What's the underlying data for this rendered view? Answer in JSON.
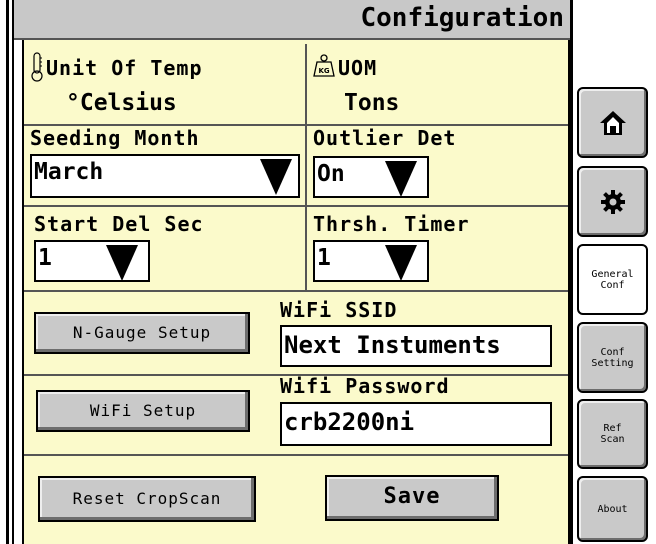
{
  "header": {
    "title": "Configuration"
  },
  "unit_of_temp": {
    "label": "Unit Of Temp",
    "value": "°Celsius",
    "icon": "thermometer-icon"
  },
  "uom": {
    "label": "UOM",
    "value": "Tons",
    "icon": "weight-kg-icon"
  },
  "seeding_month": {
    "label": "Seeding Month",
    "value": "March"
  },
  "outlier_det": {
    "label": "Outlier Det",
    "value": "On"
  },
  "start_del_sec": {
    "label": "Start Del Sec",
    "value": "1"
  },
  "thrsh_timer": {
    "label": "Thrsh. Timer",
    "value": "1"
  },
  "wifi_ssid": {
    "label": "WiFi SSID",
    "value": "Next Instuments"
  },
  "wifi_password": {
    "label": "Wifi Password",
    "value": "crb2200ni"
  },
  "buttons": {
    "n_gauge_setup": "N-Gauge Setup",
    "wifi_setup": "WiFi Setup",
    "reset_cropscan": "Reset CropScan",
    "save": "Save"
  },
  "sidebar": {
    "home_icon": "home-icon",
    "settings_icon": "gear-icon",
    "general_conf": "General Conf",
    "conf_setting": "Conf Setting",
    "ref_scan": "Ref Scan",
    "about": "About"
  },
  "colors": {
    "panel_bg": "#fbfacb",
    "button_gray": "#c9c9c9",
    "title_gray": "#c8c8c8"
  }
}
